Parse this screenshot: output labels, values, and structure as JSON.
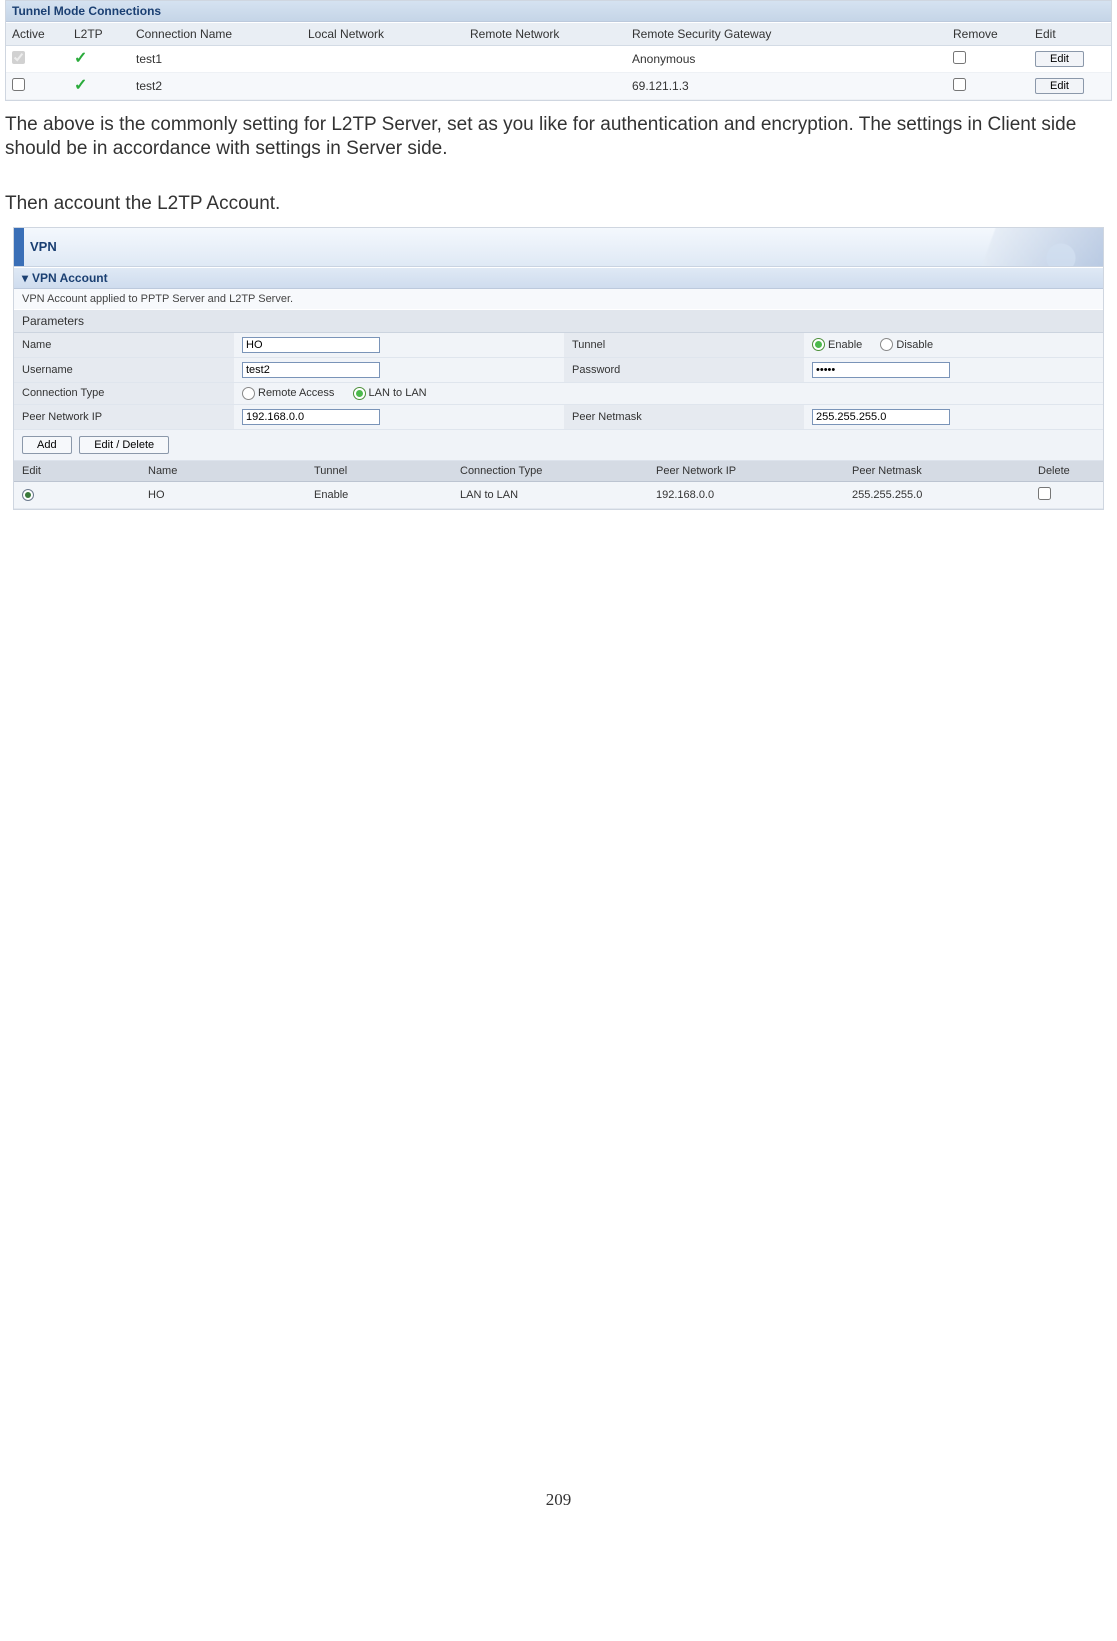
{
  "tunnel": {
    "title": "Tunnel Mode Connections",
    "headers": [
      "Active",
      "L2TP",
      "Connection Name",
      "Local Network",
      "Remote Network",
      "Remote Security Gateway",
      "Remove",
      "Edit"
    ],
    "rows": [
      {
        "active": true,
        "l2tp": true,
        "name": "test1",
        "local": "",
        "remote": "",
        "gateway": "Anonymous",
        "edit_label": "Edit"
      },
      {
        "active": false,
        "l2tp": true,
        "name": "test2",
        "local": "",
        "remote": "",
        "gateway": "69.121.1.3",
        "edit_label": "Edit"
      }
    ]
  },
  "para1": "The above is the commonly setting for L2TP Server, set as you like for authentication and encryption. The settings in Client side should be in accordance with settings in Server side.",
  "para2": "Then account the L2TP Account.",
  "vpn": {
    "top_title": "VPN",
    "section_title": "VPN Account",
    "note": "VPN Account applied to PPTP Server and L2TP Server.",
    "parameters_label": "Parameters",
    "labels": {
      "name": "Name",
      "tunnel": "Tunnel",
      "enable": "Enable",
      "disable": "Disable",
      "username": "Username",
      "password": "Password",
      "conn_type": "Connection Type",
      "remote_access": "Remote Access",
      "lan_to_lan": "LAN to LAN",
      "peer_ip": "Peer Network IP",
      "peer_mask": "Peer Netmask"
    },
    "values": {
      "name": "HO",
      "username": "test2",
      "password": "•••••",
      "tunnel_enabled": true,
      "conn_type_lan": true,
      "peer_ip": "192.168.0.0",
      "peer_mask": "255.255.255.0"
    },
    "buttons": {
      "add": "Add",
      "edit_delete": "Edit / Delete"
    },
    "list_headers": [
      "Edit",
      "Name",
      "Tunnel",
      "Connection Type",
      "Peer Network IP",
      "Peer Netmask",
      "Delete"
    ],
    "list_rows": [
      {
        "name": "HO",
        "tunnel": "Enable",
        "conn_type": "LAN to LAN",
        "peer_ip": "192.168.0.0",
        "peer_mask": "255.255.255.0"
      }
    ]
  },
  "page_number": "209"
}
